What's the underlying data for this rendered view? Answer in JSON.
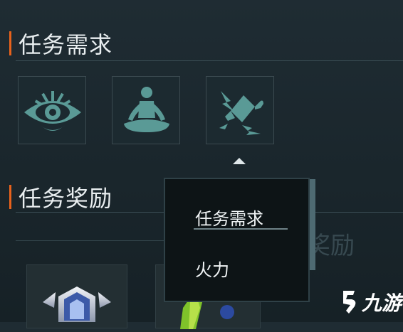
{
  "requirements": {
    "title": "任务需求",
    "icons": [
      "eye-icon",
      "meditation-icon",
      "firepower-icon"
    ]
  },
  "rewards": {
    "title": "任务奖励",
    "background_label": "基础奖励",
    "badge_icons": [
      "rank-badge-icon",
      "green-item-icon"
    ]
  },
  "popup": {
    "items": [
      "任务需求",
      "火力"
    ]
  },
  "watermark": {
    "text": "九游"
  },
  "colors": {
    "accent": "#e8621c",
    "icon_teal": "#5a9a96",
    "background": "#1f2c33"
  }
}
